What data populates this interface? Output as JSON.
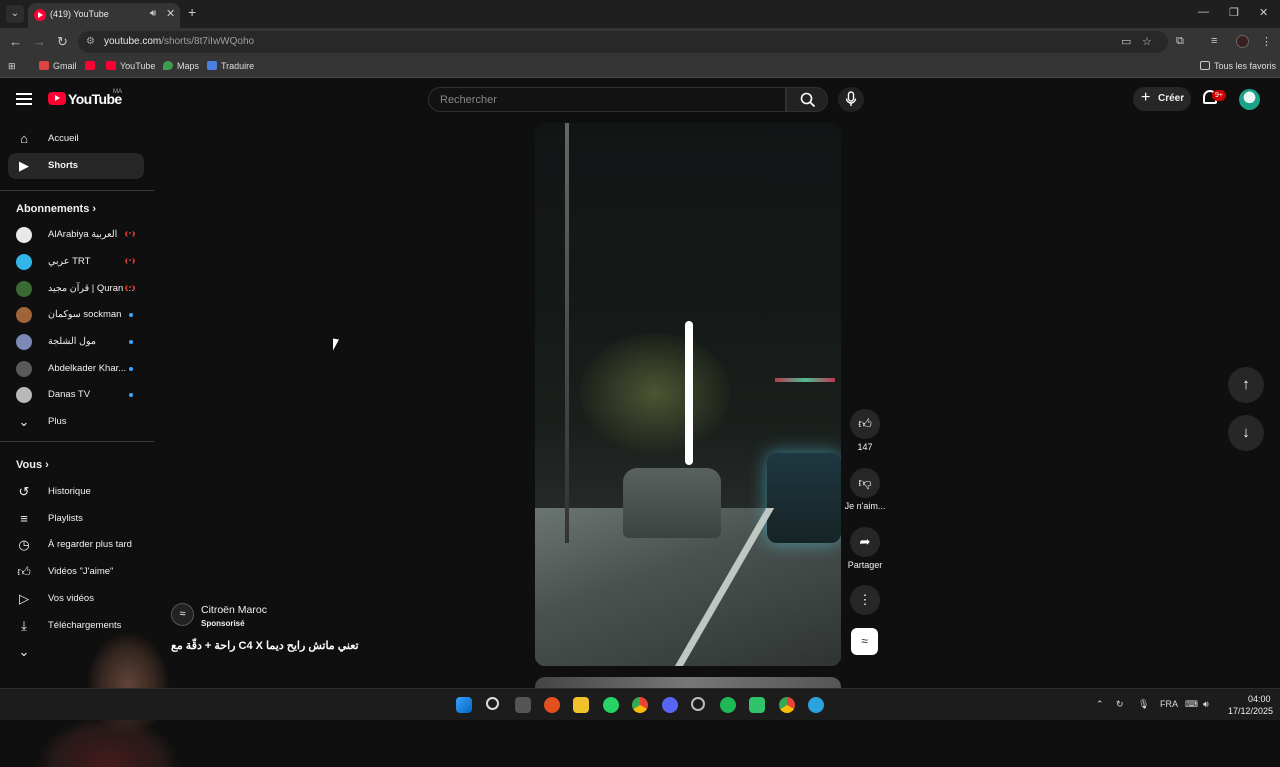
{
  "browser": {
    "tab_title": "(419) YouTube",
    "url_host": "youtube.com",
    "url_path": "/shorts/8t7iIwWQoho",
    "bookmarks": [
      "Gmail",
      "",
      "YouTube",
      "Maps",
      "Traduire"
    ],
    "all_bookmarks": "Tous les favoris"
  },
  "yt": {
    "logo_text": "YouTube",
    "country": "MA",
    "search_placeholder": "Rechercher",
    "create_label": "Créer",
    "notif_count": "9+"
  },
  "sidebar": {
    "main": [
      {
        "label": "Accueil",
        "icon": "home-icon"
      },
      {
        "label": "Shorts",
        "icon": "shorts-icon"
      }
    ],
    "subscriptions_title": "Abonnements",
    "subscriptions": [
      {
        "label": "AlArabiya العربية",
        "status": "live",
        "color": "#e9e9e9"
      },
      {
        "label": "عربي TRT",
        "status": "live",
        "color": "#32b5e8"
      },
      {
        "label": "قرآن مجيد | Quran ...",
        "status": "live",
        "color": "#3a6a34"
      },
      {
        "label": "سوكمان sockman",
        "status": "new",
        "color": "#a0643a"
      },
      {
        "label": "مول الشلجة",
        "status": "new",
        "color": "#7b89b5"
      },
      {
        "label": "Abdelkader Khar...",
        "status": "new",
        "color": "#5a5a5a"
      },
      {
        "label": "Danas TV",
        "status": "new",
        "color": "#b9b9b9"
      }
    ],
    "more_label": "Plus",
    "you_title": "Vous",
    "you_items": [
      {
        "label": "Historique",
        "icon": "history-icon"
      },
      {
        "label": "Playlists",
        "icon": "playlists-icon"
      },
      {
        "label": "À regarder plus tard",
        "icon": "watch-later-icon"
      },
      {
        "label": "Vidéos \"J'aime\"",
        "icon": "liked-videos-icon"
      },
      {
        "label": "Vos vidéos",
        "icon": "your-videos-icon"
      },
      {
        "label": "Téléchargements",
        "icon": "downloads-icon"
      }
    ]
  },
  "short": {
    "channel": "Citroën Maroc",
    "sponsored": "Sponsorisé",
    "title": "تعني ماتش رايح ديما C4 X راحة + دقّة مع",
    "likes": "147",
    "dislike_label": "Je n'aim...",
    "share_label": "Partager"
  },
  "taskbar": {
    "lang": "FRA",
    "time": "04:00",
    "date": "17/12/2025"
  }
}
